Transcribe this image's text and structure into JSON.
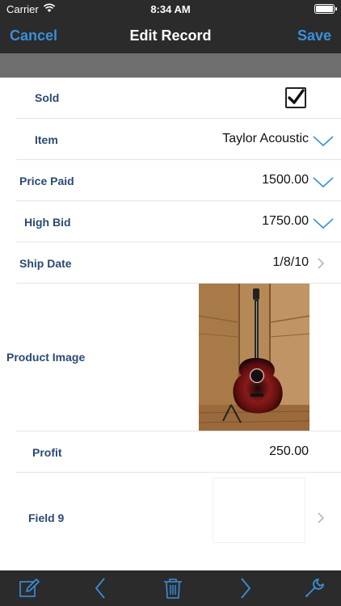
{
  "status_bar": {
    "carrier": "Carrier",
    "time": "8:34 AM"
  },
  "nav": {
    "title": "Edit Record",
    "left_button": "Cancel",
    "right_button": "Save",
    "accent_color": "#3a8fd9"
  },
  "fields": {
    "sold": {
      "label": "Sold",
      "checked": true
    },
    "item": {
      "label": "Item",
      "value": "Taylor Acoustic"
    },
    "price_paid": {
      "label": "Price Paid",
      "value": "1500.00"
    },
    "high_bid": {
      "label": "High Bid",
      "value": "1750.00"
    },
    "ship_date": {
      "label": "Ship Date",
      "value": "1/8/10"
    },
    "product_image": {
      "label": "Product Image"
    },
    "profit": {
      "label": "Profit",
      "value": "250.00"
    },
    "field9": {
      "label": "Field 9"
    }
  },
  "toolbar": {
    "icons": [
      "edit-icon",
      "back-arrow-icon",
      "trash-icon",
      "forward-arrow-icon",
      "wrench-icon"
    ]
  }
}
